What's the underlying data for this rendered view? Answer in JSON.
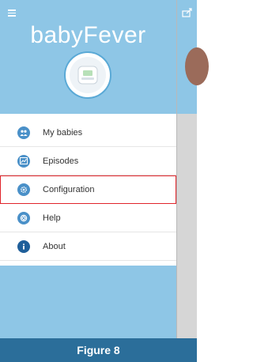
{
  "app": {
    "title": "babyFever"
  },
  "menu": {
    "items": [
      {
        "label": "My babies",
        "icon": "babies-icon"
      },
      {
        "label": "Episodes",
        "icon": "chart-icon"
      },
      {
        "label": "Configuration",
        "icon": "gear-icon",
        "highlighted": true
      },
      {
        "label": "Help",
        "icon": "lifebuoy-icon"
      },
      {
        "label": "About",
        "icon": "info-icon"
      }
    ]
  },
  "caption": {
    "text": "Figure 8"
  },
  "colors": {
    "header": "#8ec6e6",
    "icon": "#4a90c8",
    "highlight": "#e0242a",
    "caption_bg": "#2b6e9a"
  }
}
